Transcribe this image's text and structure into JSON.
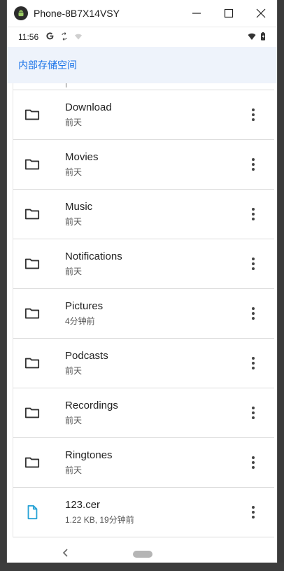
{
  "window": {
    "title": "Phone-8B7X14VSY"
  },
  "status_bar": {
    "time": "11:56"
  },
  "header": {
    "title": "内部存储空间"
  },
  "files": [
    {
      "name": "Download",
      "meta": "前天",
      "icon": "folder-icon"
    },
    {
      "name": "Movies",
      "meta": "前天",
      "icon": "folder-icon"
    },
    {
      "name": "Music",
      "meta": "前天",
      "icon": "folder-icon"
    },
    {
      "name": "Notifications",
      "meta": "前天",
      "icon": "folder-icon"
    },
    {
      "name": "Pictures",
      "meta": "4分钟前",
      "icon": "folder-icon"
    },
    {
      "name": "Podcasts",
      "meta": "前天",
      "icon": "folder-icon"
    },
    {
      "name": "Recordings",
      "meta": "前天",
      "icon": "folder-icon"
    },
    {
      "name": "Ringtones",
      "meta": "前天",
      "icon": "folder-icon"
    },
    {
      "name": "123.cer",
      "meta": "1.22 KB, 19分钟前",
      "icon": "file-icon"
    }
  ],
  "colors": {
    "accent": "#1a73e8",
    "header_bg": "#eef3fb",
    "file_icon": "#29a3d6"
  }
}
